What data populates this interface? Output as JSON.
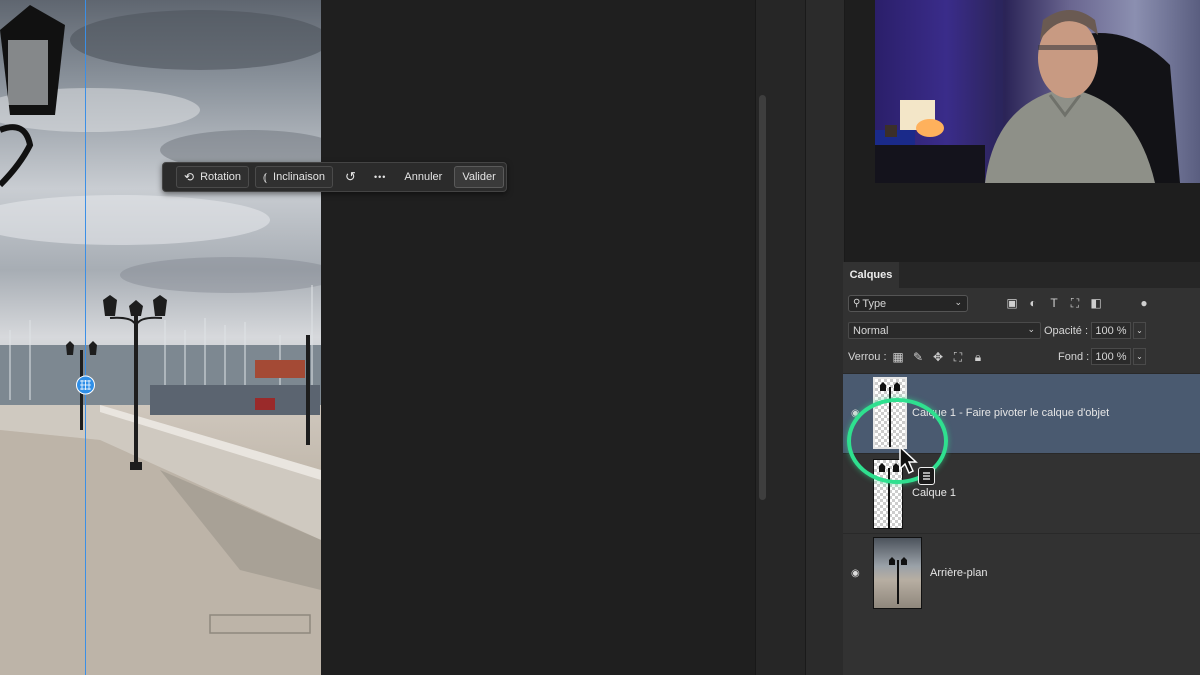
{
  "taskbar": {
    "rotation_label": "Rotation",
    "inclinaison_label": "Inclinaison",
    "more_label": "•••",
    "annuler_label": "Annuler",
    "valider_label": "Valider"
  },
  "layers_panel": {
    "tab_label": "Calques",
    "filter_value": "Type",
    "blend_mode": "Normal",
    "opacity_label": "Opacité :",
    "opacity_value": "100 %",
    "lock_label": "Verrou :",
    "fill_label": "Fond :",
    "fill_value": "100 %",
    "layers": [
      {
        "name": "Calque 1 - Faire pivoter le calque d'objet",
        "selected": true
      },
      {
        "name": "Calque 1",
        "selected": false
      },
      {
        "name": "Arrière-plan",
        "selected": false
      }
    ]
  },
  "colors": {
    "highlight": "#2fe08f",
    "selected_layer": "#4a5a70",
    "guide_line": "#3b8fe6"
  }
}
